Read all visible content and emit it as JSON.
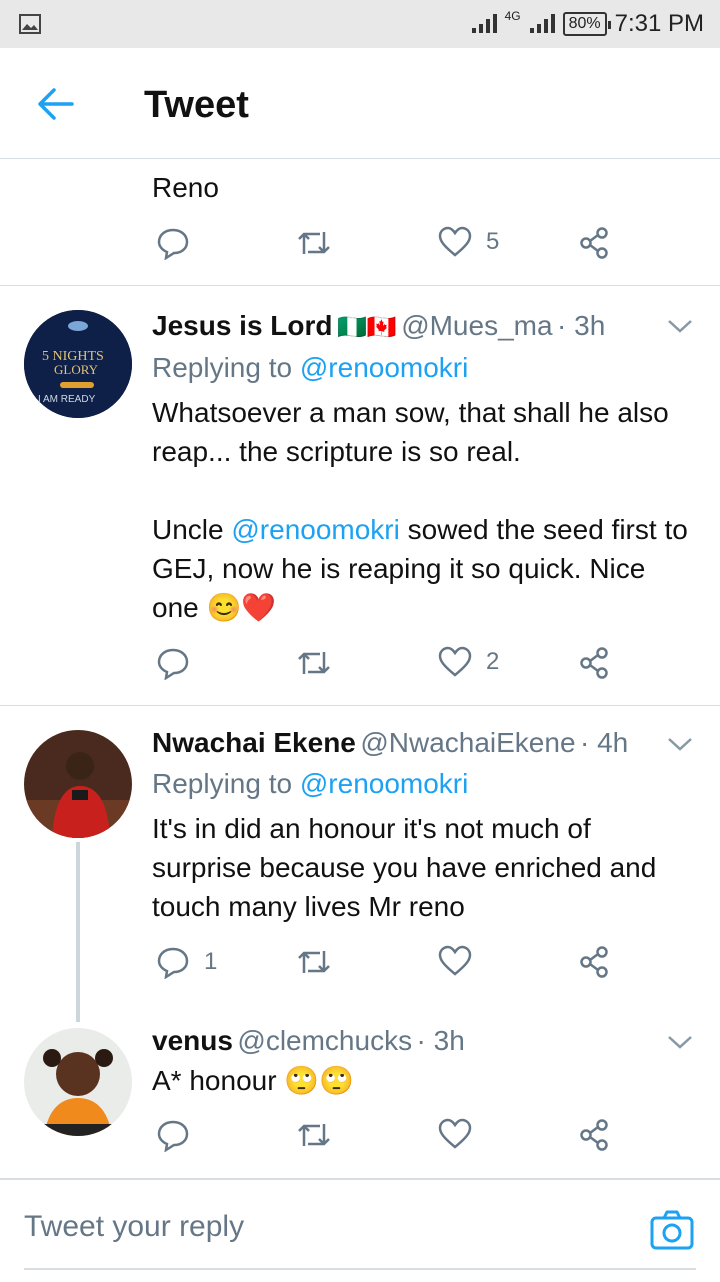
{
  "status_bar": {
    "time": "7:31 PM",
    "battery": "80%",
    "network": "4G"
  },
  "header": {
    "title": "Tweet"
  },
  "top_tweet": {
    "text": "Reno",
    "likes": "5"
  },
  "tweets": [
    {
      "name": "Jesus is Lord",
      "flags": "🇳🇬🇨🇦",
      "handle": "@Mues_ma",
      "time": "· 3h",
      "replying_prefix": "Replying to ",
      "replying_to": "@renoomokri",
      "text_1": "Whatsoever a man sow, that shall he also reap... the scripture is so real.",
      "text_2_pre": "Uncle ",
      "text_2_mention": "@renoomokri",
      "text_2_post": " sowed the seed first to GEJ, now he is reaping it so quick. Nice one 😊❤️",
      "likes": "2",
      "avatar": {
        "line1": "5 NIGHTS",
        "line2": "GLORY",
        "line3": "I AM READY"
      }
    },
    {
      "name": "Nwachai Ekene",
      "handle": "@NwachaiEkene",
      "time": "· 4h",
      "replying_prefix": "Replying to ",
      "replying_to": "@renoomokri",
      "text": "It's in did an honour it's not much of surprise because you have enriched and touch many lives Mr reno",
      "replies": "1"
    },
    {
      "name": "venus",
      "handle": "@clemchucks",
      "time": "· 3h",
      "text": "A* honour  🙄🙄"
    }
  ],
  "reply_bar": {
    "placeholder": "Tweet your reply"
  },
  "colors": {
    "accent": "#1da1f2",
    "muted": "#657786",
    "divider": "#d8dde1"
  }
}
